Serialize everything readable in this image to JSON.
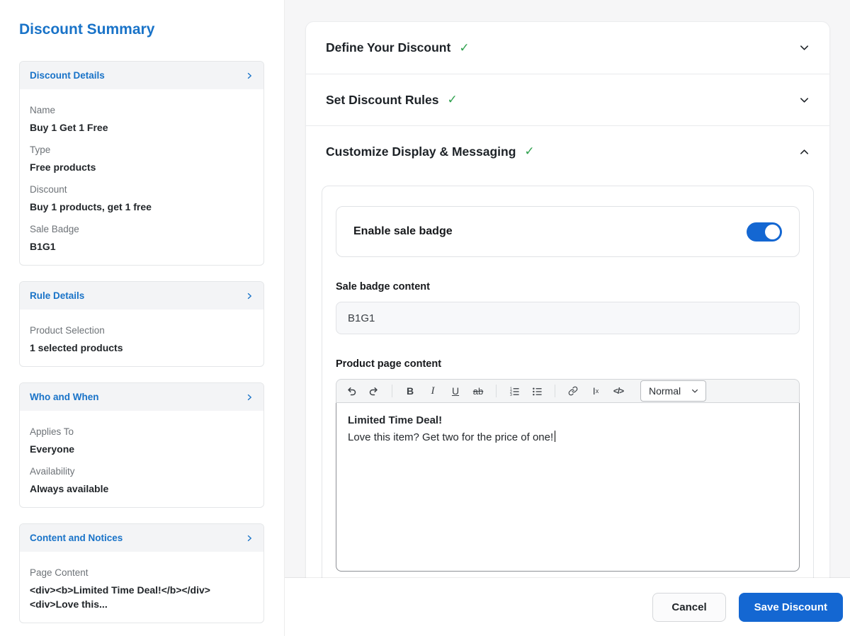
{
  "colors": {
    "primary-blue": "#1467d2",
    "link-blue": "#1973c8",
    "check-green": "#2fa14e"
  },
  "icons": {
    "check": "✓"
  },
  "sidebar": {
    "title": "Discount Summary",
    "sections": [
      {
        "title": "Discount Details",
        "fields": [
          {
            "label": "Name",
            "value": "Buy 1 Get 1 Free"
          },
          {
            "label": "Type",
            "value": "Free products"
          },
          {
            "label": "Discount",
            "value": "Buy 1 products, get 1 free"
          },
          {
            "label": "Sale Badge",
            "value": "B1G1"
          }
        ]
      },
      {
        "title": "Rule Details",
        "fields": [
          {
            "label": "Product Selection",
            "value": "1 selected products"
          }
        ]
      },
      {
        "title": "Who and When",
        "fields": [
          {
            "label": "Applies To",
            "value": "Everyone"
          },
          {
            "label": "Availability",
            "value": "Always available"
          }
        ]
      },
      {
        "title": "Content and Notices",
        "fields": [
          {
            "label": "Page Content",
            "value": "<div><b>Limited Time Deal!</b></div><div>Love this..."
          }
        ]
      }
    ]
  },
  "accordion": {
    "items": [
      {
        "title": "Define Your Discount"
      },
      {
        "title": "Set Discount Rules"
      },
      {
        "title": "Customize Display & Messaging"
      }
    ]
  },
  "messaging_panel": {
    "enable_badge_label": "Enable sale badge",
    "toggle_state": "on",
    "sale_badge_content_label": "Sale badge content",
    "sale_badge_content_value": "B1G1",
    "product_page_content_label": "Product page content",
    "editor": {
      "toolbar": {
        "bold": "B",
        "italic": "I",
        "underline": "U",
        "strike": "ab",
        "clear_main": "I",
        "clear_sub": "x",
        "code": "</>",
        "format_value": "Normal"
      },
      "content_line1": "Limited Time Deal!",
      "content_line2": "Love this item? Get two for the price of one!"
    }
  },
  "footer": {
    "cancel_label": "Cancel",
    "save_label": "Save Discount"
  }
}
